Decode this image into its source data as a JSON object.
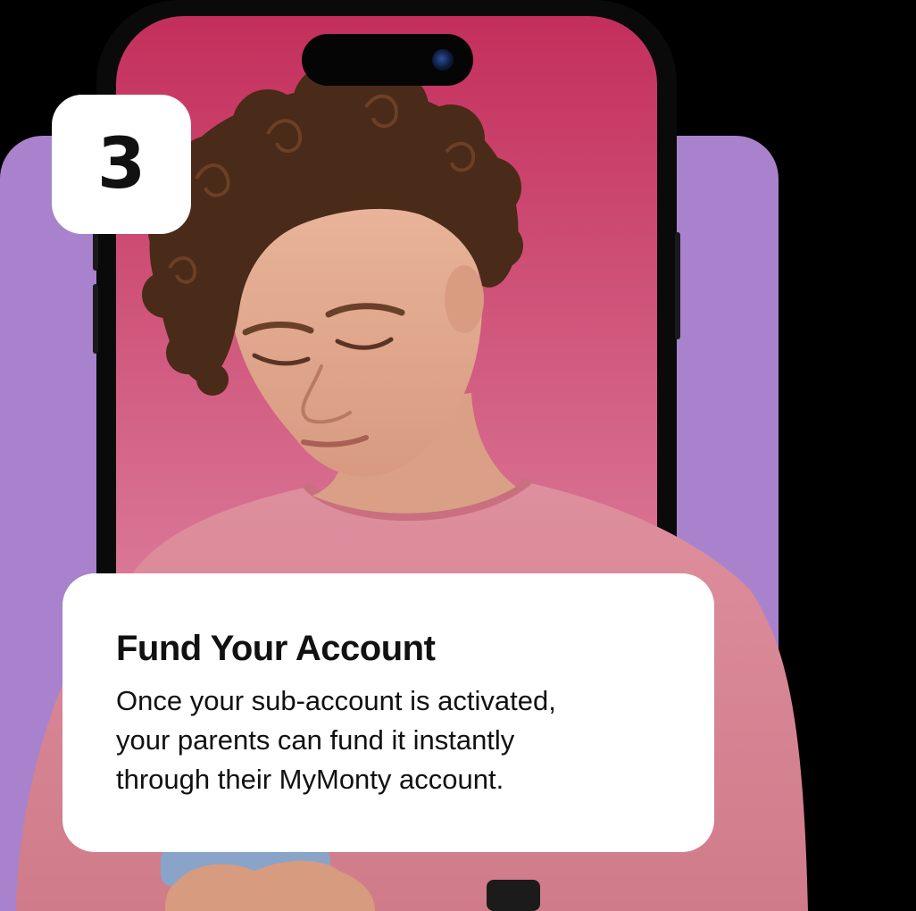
{
  "step": {
    "number": "3"
  },
  "card": {
    "title": "Fund Your Account",
    "body_lines": [
      "Once your sub-account is activated,",
      "your parents can fund it instantly",
      "through their MyMonty account."
    ]
  },
  "colors": {
    "background": "#000000",
    "purple_accent": "#a882cc",
    "screen_top": "#c42f5c",
    "screen_bottom": "#e8a6bd",
    "shirt": "#d98897",
    "card": "#ffffff",
    "text": "#111111"
  },
  "icons": {
    "camera": "front-camera-icon"
  }
}
